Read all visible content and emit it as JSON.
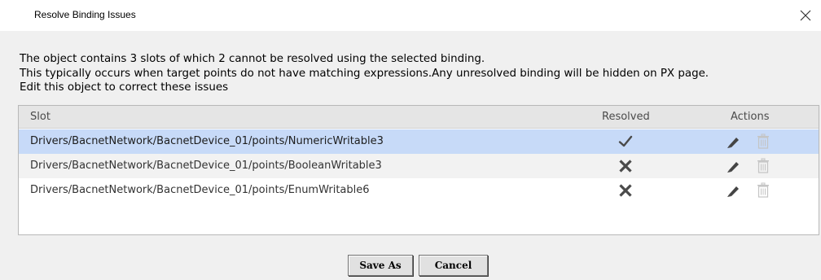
{
  "dialog": {
    "title": "Resolve Binding Issues",
    "message_lines": [
      "The object contains 3 slots of which 2 cannot be resolved using the selected binding.",
      "This typically occurs when target points do not have matching expressions.Any unresolved binding will be hidden on PX page.",
      "Edit this object to correct these issues"
    ]
  },
  "table": {
    "columns": [
      "Slot",
      "Resolved",
      "Actions"
    ],
    "rows": [
      {
        "slot": "Drivers/BacnetNetwork/BacnetDevice_01/points/NumericWritable3",
        "resolved": true,
        "selected": true
      },
      {
        "slot": "Drivers/BacnetNetwork/BacnetDevice_01/points/BooleanWritable3",
        "resolved": false,
        "selected": false
      },
      {
        "slot": "Drivers/BacnetNetwork/BacnetDevice_01/points/EnumWritable6",
        "resolved": false,
        "selected": false
      }
    ]
  },
  "buttons": {
    "save_as": "Save As",
    "cancel": "Cancel"
  },
  "icons": {
    "close": "close-icon",
    "resolved": "check-icon",
    "unresolved": "x-icon",
    "edit": "pencil-icon",
    "delete": "trash-icon"
  },
  "colors": {
    "selected_row": "#c7daf8",
    "header": "#e5e5e5",
    "icon_dark": "#444444",
    "icon_light": "#c4c4c4"
  }
}
